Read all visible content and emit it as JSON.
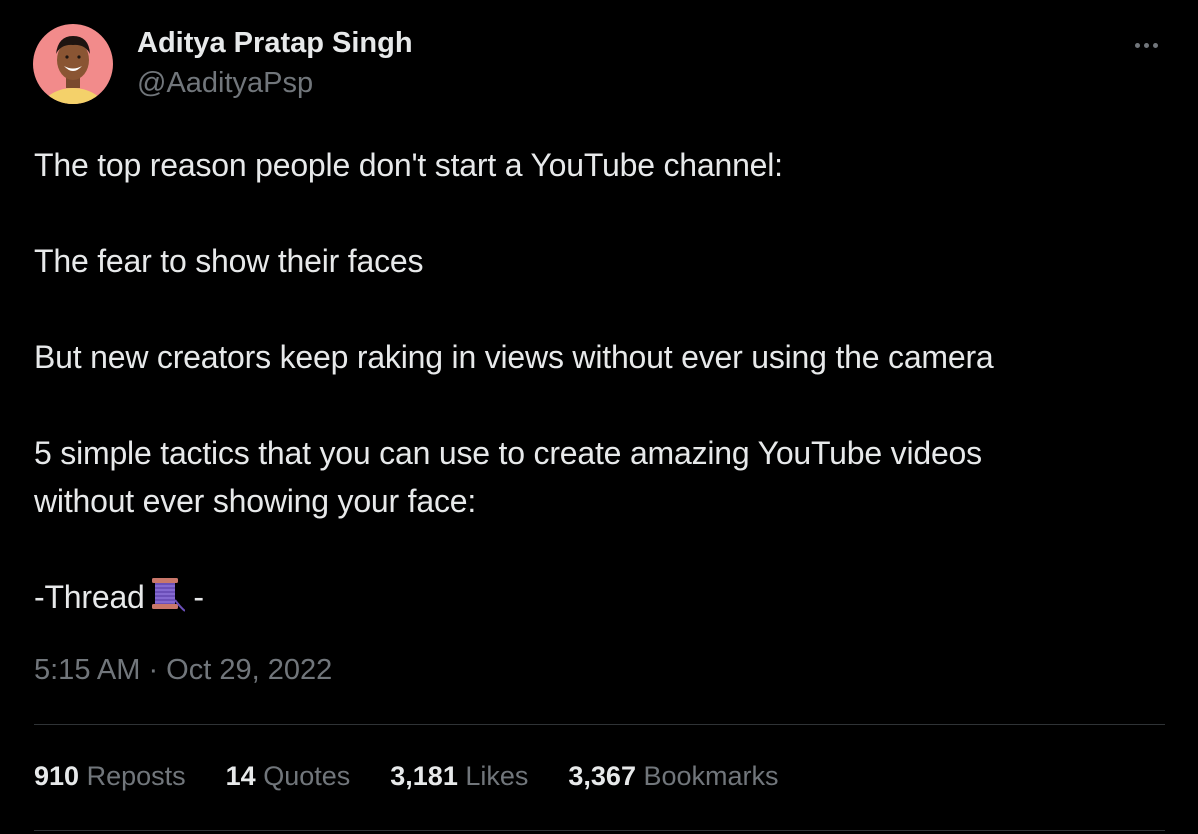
{
  "author": {
    "display_name": "Aditya Pratap Singh",
    "handle": "@AadityaPsp",
    "avatar_icon": "profile-photo",
    "avatar_bg": "#f28b8b"
  },
  "more_icon": "ellipsis-icon",
  "tweet": {
    "paragraphs": [
      "The top reason people don't start a YouTube channel:",
      "The fear to show their faces",
      "But new creators keep raking in views without ever using the camera"
    ],
    "tactics_line_1": "5 simple tactics that you can use to create amazing YouTube videos",
    "tactics_line_2": "without ever showing your face:",
    "thread_prefix": "-Thread",
    "thread_suffix": " -",
    "thread_emoji": "spool-of-thread-icon"
  },
  "timestamp": "5:15 AM · Oct 29, 2022",
  "stats": {
    "reposts_count": "910",
    "reposts_label": "Reposts",
    "quotes_count": "14",
    "quotes_label": "Quotes",
    "likes_count": "3,181",
    "likes_label": "Likes",
    "bookmarks_count": "3,367",
    "bookmarks_label": "Bookmarks"
  },
  "colors": {
    "background": "#000000",
    "primary_text": "#e7e9ea",
    "secondary_text": "#71767b",
    "divider": "#2f3336"
  }
}
